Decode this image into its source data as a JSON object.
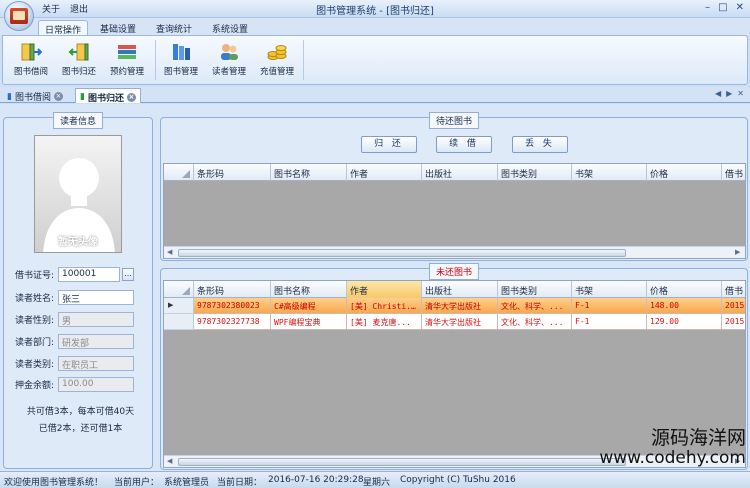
{
  "window": {
    "title": "图书管理系统 - [图书归还]",
    "quick_menu": [
      "关于",
      "退出"
    ]
  },
  "ribbon": {
    "tabs": [
      "日常操作",
      "基础设置",
      "查询统计",
      "系统设置"
    ],
    "active_tab": "日常操作",
    "buttons": [
      {
        "label": "图书借阅",
        "icon": "book-borrow-icon"
      },
      {
        "label": "图书归还",
        "icon": "book-return-icon"
      },
      {
        "label": "预约管理",
        "icon": "reservation-icon"
      },
      {
        "label": "图书管理",
        "icon": "book-stack-icon"
      },
      {
        "label": "读者管理",
        "icon": "readers-icon"
      },
      {
        "label": "充值管理",
        "icon": "coins-icon"
      }
    ]
  },
  "doc_tabs": [
    {
      "label": "图书借阅"
    },
    {
      "label": "图书归还"
    }
  ],
  "reader": {
    "group_title": "读者信息",
    "avatar_caption": "暂无头像",
    "fields": [
      {
        "label": "借书证号:",
        "value": "100001",
        "readonly": false
      },
      {
        "label": "读者姓名:",
        "value": "张三",
        "readonly": false
      },
      {
        "label": "读者性别:",
        "value": "男",
        "readonly": true
      },
      {
        "label": "读者部门:",
        "value": "研发部",
        "readonly": true
      },
      {
        "label": "读者类别:",
        "value": "在职员工",
        "readonly": true
      },
      {
        "label": "押金余额:",
        "value": "100.00",
        "readonly": true
      }
    ],
    "browse_button": "...",
    "summary_line1": "共可借3本，每本可借40天",
    "summary_line2": "已借2本，还可借1本"
  },
  "pending": {
    "group_title": "待还图书",
    "actions": [
      "归 还",
      "续 借",
      "丢 失"
    ],
    "columns": [
      "条形码",
      "图书名称",
      "作者",
      "出版社",
      "图书类别",
      "书架",
      "价格",
      "借书"
    ]
  },
  "borrowed": {
    "group_title": "未还图书",
    "columns": [
      "条形码",
      "图书名称",
      "作者",
      "出版社",
      "图书类别",
      "书架",
      "价格",
      "借书"
    ],
    "rows": [
      [
        "9787302380023",
        "C#高级编程",
        "[美] Christi...",
        "清华大学出版社",
        "文化、科学、...",
        "F-1",
        "148.00",
        "2015-"
      ],
      [
        "9787302327738",
        "WPF编程宝典",
        "[美] 麦克唐...",
        "清华大学出版社",
        "文化、科学、...",
        "F-1",
        "129.00",
        "2015-"
      ]
    ],
    "selected_row": 0
  },
  "statusbar": {
    "welcome": "欢迎使用图书管理系统！",
    "user_label": "当前用户：",
    "user": "系统管理员",
    "date_label": "当前日期：",
    "date": "2016-07-16 20:29:28",
    "weekday": "星期六",
    "copyright": "Copyright (C) TuShu 2016"
  },
  "watermark": {
    "line1": "源码海洋网",
    "line2": "www.codehy.com"
  }
}
